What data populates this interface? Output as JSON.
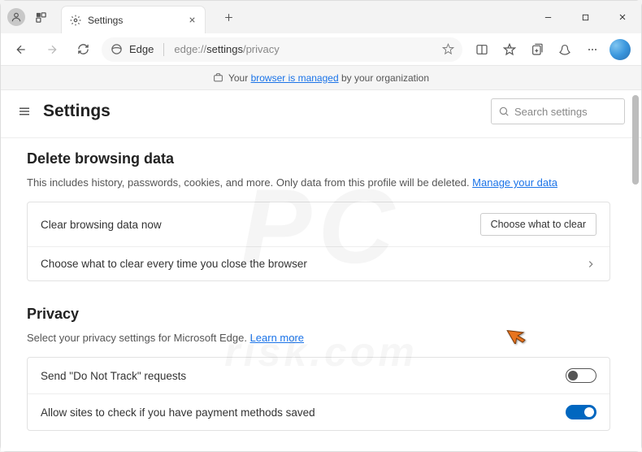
{
  "tab": {
    "title": "Settings"
  },
  "url": {
    "label": "Edge",
    "path_prefix": "edge://",
    "path_mid": "settings",
    "path_rest": "/privacy"
  },
  "managed": {
    "prefix": "Your ",
    "link": "browser is managed",
    "suffix": " by your organization"
  },
  "header": {
    "title": "Settings"
  },
  "search": {
    "placeholder": "Search settings"
  },
  "delete_section": {
    "title": "Delete browsing data",
    "subtitle_text": "This includes history, passwords, cookies, and more. Only data from this profile will be deleted. ",
    "subtitle_link": "Manage your data",
    "row1_label": "Clear browsing data now",
    "row1_button": "Choose what to clear",
    "row2_label": "Choose what to clear every time you close the browser"
  },
  "privacy_section": {
    "title": "Privacy",
    "subtitle_text": "Select your privacy settings for Microsoft Edge. ",
    "subtitle_link": "Learn more",
    "row1_label": "Send \"Do Not Track\" requests",
    "row2_label": "Allow sites to check if you have payment methods saved"
  }
}
